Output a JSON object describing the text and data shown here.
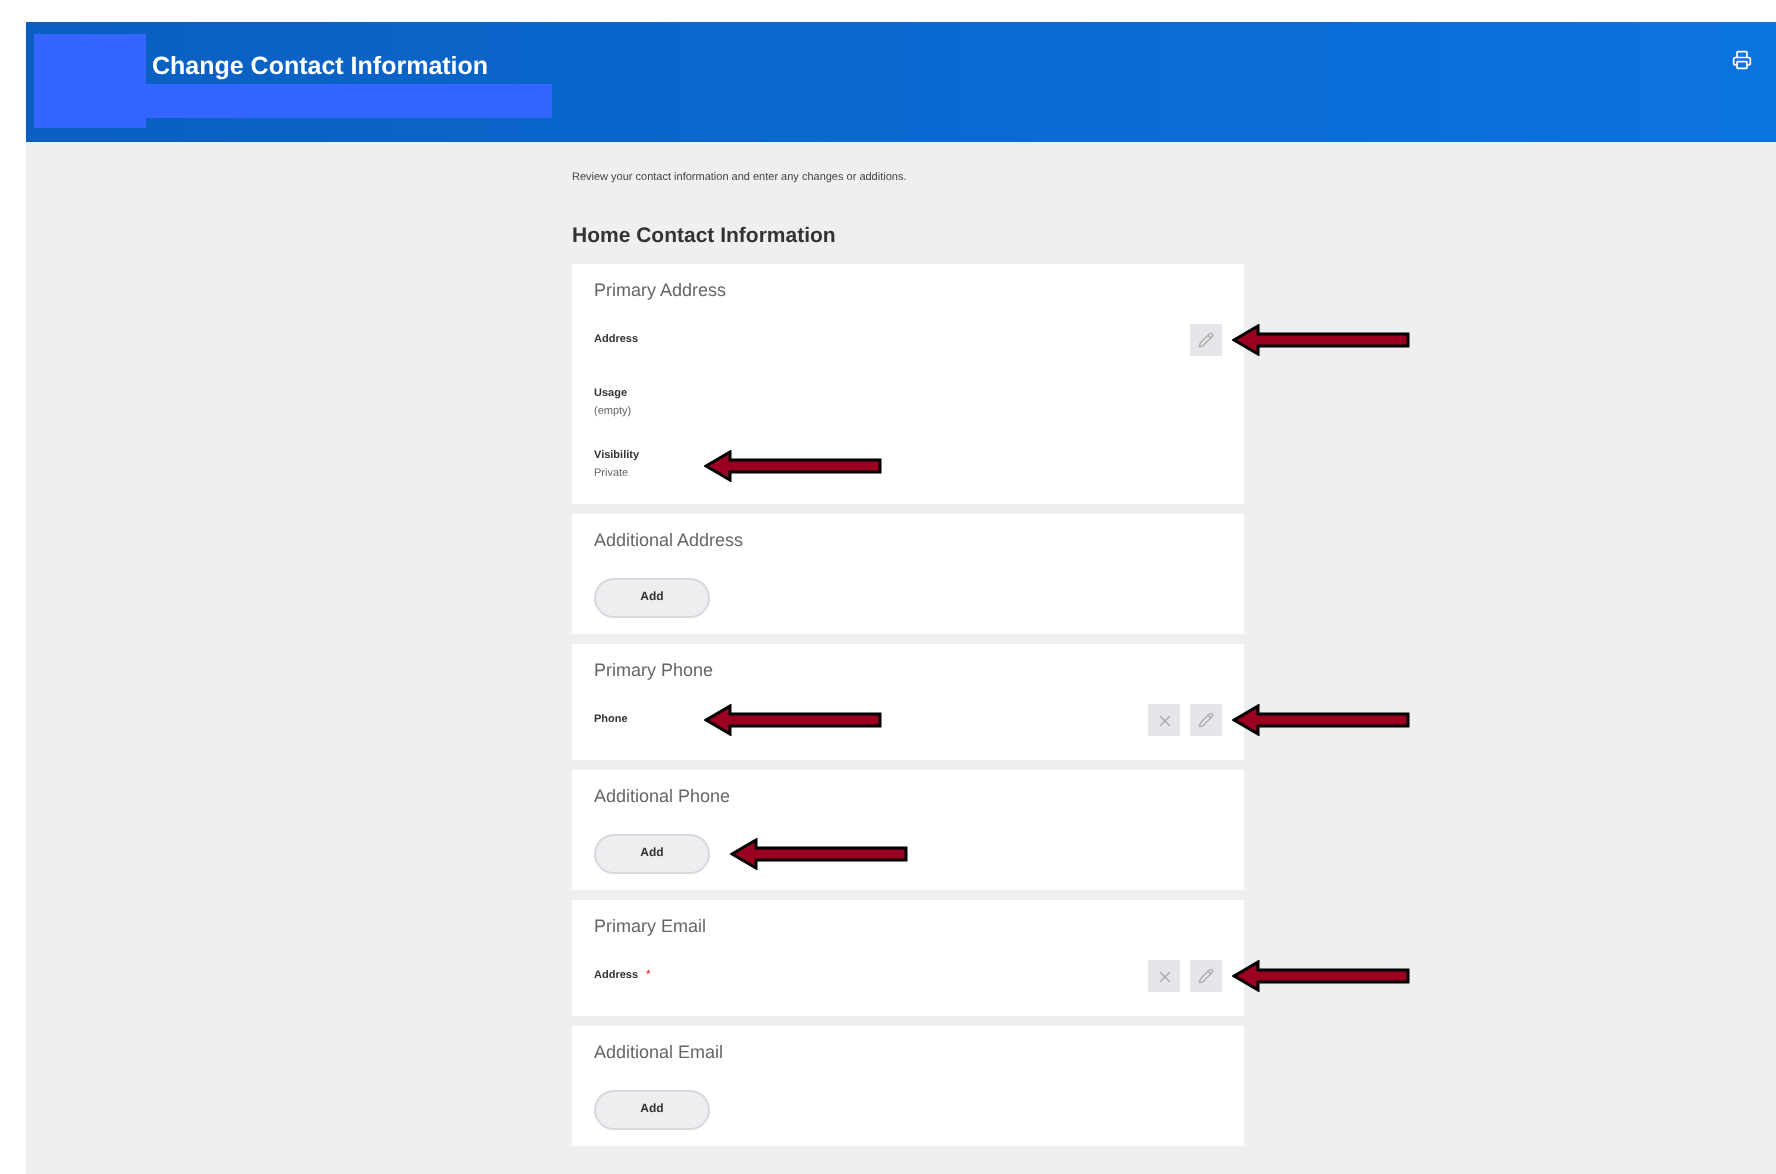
{
  "header": {
    "title": "Change Contact Information"
  },
  "intro": "Review your contact information and enter any changes or additions.",
  "heading": "Home Contact Information",
  "sections": [
    {
      "title": "Primary Address",
      "kind": "fields",
      "fields": [
        {
          "label": "Address",
          "pointer": false,
          "actions": [
            {
              "kind": "edit"
            }
          ],
          "actions_pointer": true
        },
        {
          "label": "Usage",
          "value": "(empty)",
          "pointer": false
        },
        {
          "label": "Visibility",
          "value": "Private",
          "pointer": true
        }
      ]
    },
    {
      "title": "Additional Address",
      "kind": "add",
      "button": "Add",
      "pointer": false
    },
    {
      "title": "Primary Phone",
      "kind": "fields",
      "fields": [
        {
          "label": "Phone",
          "pointer": true,
          "actions": [
            {
              "kind": "delete"
            },
            {
              "kind": "edit"
            }
          ],
          "actions_pointer": true
        }
      ]
    },
    {
      "title": "Additional Phone",
      "kind": "add",
      "button": "Add",
      "pointer": true
    },
    {
      "title": "Primary Email",
      "kind": "fields",
      "fields": [
        {
          "label": "Address",
          "required_mark": "*",
          "pointer": false,
          "actions": [
            {
              "kind": "delete"
            },
            {
              "kind": "edit"
            }
          ],
          "actions_pointer": true
        }
      ]
    },
    {
      "title": "Additional Email",
      "kind": "add",
      "button": "Add",
      "pointer": false
    }
  ]
}
